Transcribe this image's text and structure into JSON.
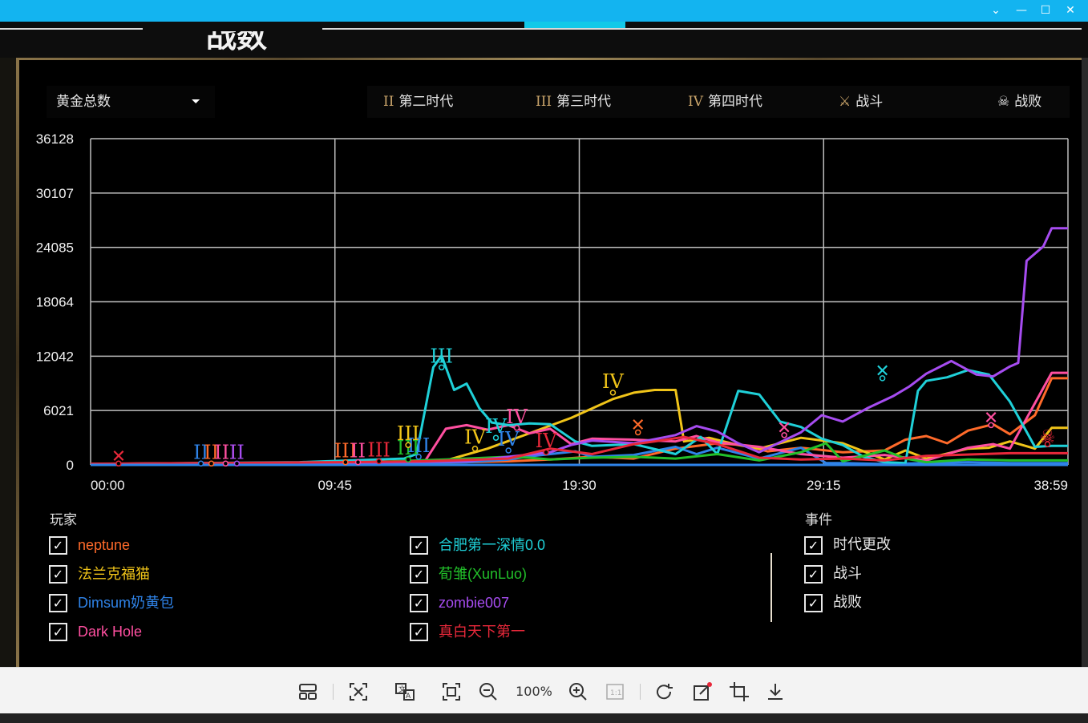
{
  "header": {
    "title": "战数"
  },
  "window_buttons": {
    "dropdown": "⌄",
    "minimize": "—",
    "maximize": "☐",
    "close": "✕"
  },
  "stat_select": {
    "value": "黄金总数",
    "arrow": "⏷"
  },
  "events_bar": [
    {
      "roman": "II",
      "label": "第二时代"
    },
    {
      "roman": "III",
      "label": "第三时代"
    },
    {
      "roman": "IV",
      "label": "第四时代"
    },
    {
      "icon": "⚔",
      "label": "战斗"
    },
    {
      "icon": "☠",
      "label": "战败"
    }
  ],
  "chart_data": {
    "type": "line",
    "y_ticks": [
      "36128",
      "30107",
      "24085",
      "18064",
      "12042",
      "6021",
      "0"
    ],
    "x_ticks": [
      "00:00",
      "09:45",
      "19:30",
      "29:15",
      "38:59"
    ],
    "ylim": [
      0,
      36128
    ],
    "grid": true,
    "x_range_seconds": [
      0,
      2339
    ],
    "series": [
      {
        "name": "neptune",
        "color": "#ff6a2a",
        "points": [
          [
            0,
            100
          ],
          [
            300,
            200
          ],
          [
            600,
            150
          ],
          [
            900,
            300
          ],
          [
            1000,
            400
          ],
          [
            1100,
            600
          ],
          [
            1200,
            900
          ],
          [
            1300,
            700
          ],
          [
            1400,
            1800
          ],
          [
            1500,
            2400
          ],
          [
            1560,
            2200
          ],
          [
            1620,
            1500
          ],
          [
            1700,
            1900
          ],
          [
            1800,
            1400
          ],
          [
            1900,
            1600
          ],
          [
            1950,
            2800
          ],
          [
            2000,
            3200
          ],
          [
            2050,
            2400
          ],
          [
            2100,
            3800
          ],
          [
            2160,
            4500
          ],
          [
            2200,
            3400
          ],
          [
            2260,
            5500
          ],
          [
            2300,
            9600
          ],
          [
            2339,
            9600
          ]
        ]
      },
      {
        "name": "法兰克福猫",
        "color": "#f0c419",
        "points": [
          [
            0,
            80
          ],
          [
            600,
            200
          ],
          [
            850,
            500
          ],
          [
            950,
            1800
          ],
          [
            1050,
            3500
          ],
          [
            1150,
            5200
          ],
          [
            1250,
            7300
          ],
          [
            1300,
            8000
          ],
          [
            1350,
            8300
          ],
          [
            1400,
            8300
          ],
          [
            1420,
            2600
          ],
          [
            1480,
            3000
          ],
          [
            1550,
            2200
          ],
          [
            1600,
            1800
          ],
          [
            1700,
            3000
          ],
          [
            1800,
            2400
          ],
          [
            1900,
            600
          ],
          [
            1950,
            1600
          ],
          [
            2000,
            700
          ],
          [
            2100,
            1800
          ],
          [
            2150,
            1900
          ],
          [
            2200,
            2600
          ],
          [
            2260,
            1800
          ],
          [
            2300,
            4100
          ],
          [
            2339,
            4100
          ]
        ]
      },
      {
        "name": "Dimsum奶黄包",
        "color": "#2f83e8",
        "points": [
          [
            0,
            60
          ],
          [
            300,
            100
          ],
          [
            600,
            150
          ],
          [
            900,
            300
          ],
          [
            1000,
            600
          ],
          [
            1060,
            1000
          ],
          [
            1100,
            1200
          ],
          [
            1160,
            1500
          ],
          [
            1200,
            900
          ],
          [
            1300,
            1100
          ],
          [
            1400,
            2000
          ],
          [
            1450,
            1200
          ],
          [
            1500,
            1900
          ],
          [
            1600,
            700
          ],
          [
            1700,
            1900
          ],
          [
            1760,
            200
          ],
          [
            1800,
            200
          ],
          [
            1900,
            100
          ],
          [
            2100,
            300
          ],
          [
            2200,
            200
          ],
          [
            2339,
            200
          ]
        ]
      },
      {
        "name": "Dark Hole",
        "color": "#ff4fa0",
        "points": [
          [
            0,
            70
          ],
          [
            300,
            120
          ],
          [
            600,
            250
          ],
          [
            800,
            400
          ],
          [
            850,
            4000
          ],
          [
            900,
            4400
          ],
          [
            950,
            3900
          ],
          [
            1000,
            4400
          ],
          [
            1050,
            3500
          ],
          [
            1100,
            4000
          ],
          [
            1150,
            2300
          ],
          [
            1200,
            2900
          ],
          [
            1300,
            2800
          ],
          [
            1400,
            2600
          ],
          [
            1450,
            3200
          ],
          [
            1500,
            2500
          ],
          [
            1600,
            2000
          ],
          [
            1700,
            1200
          ],
          [
            1800,
            800
          ],
          [
            1900,
            1100
          ],
          [
            2000,
            500
          ],
          [
            2100,
            1900
          ],
          [
            2160,
            2300
          ],
          [
            2200,
            1800
          ],
          [
            2300,
            10200
          ],
          [
            2339,
            10200
          ]
        ]
      },
      {
        "name": "合肥第一深情0.0",
        "color": "#1fd0d8",
        "points": [
          [
            0,
            100
          ],
          [
            500,
            300
          ],
          [
            750,
            700
          ],
          [
            780,
            1200
          ],
          [
            820,
            10800
          ],
          [
            840,
            12100
          ],
          [
            870,
            8300
          ],
          [
            900,
            9000
          ],
          [
            930,
            6300
          ],
          [
            960,
            4700
          ],
          [
            1000,
            4400
          ],
          [
            1050,
            4600
          ],
          [
            1100,
            4500
          ],
          [
            1160,
            2600
          ],
          [
            1200,
            2100
          ],
          [
            1300,
            2300
          ],
          [
            1400,
            1200
          ],
          [
            1460,
            3100
          ],
          [
            1500,
            1200
          ],
          [
            1550,
            8200
          ],
          [
            1600,
            7800
          ],
          [
            1650,
            4800
          ],
          [
            1700,
            4200
          ],
          [
            1750,
            2900
          ],
          [
            1800,
            2200
          ],
          [
            1850,
            900
          ],
          [
            1900,
            300
          ],
          [
            1950,
            200
          ],
          [
            1980,
            8200
          ],
          [
            2000,
            9300
          ],
          [
            2050,
            9700
          ],
          [
            2100,
            10500
          ],
          [
            2150,
            10000
          ],
          [
            2200,
            7000
          ],
          [
            2260,
            2000
          ],
          [
            2300,
            2100
          ],
          [
            2339,
            2100
          ]
        ]
      },
      {
        "name": "荀雏(XunLuo)",
        "color": "#22c02a",
        "points": [
          [
            0,
            50
          ],
          [
            300,
            100
          ],
          [
            600,
            200
          ],
          [
            850,
            600
          ],
          [
            900,
            700
          ],
          [
            1000,
            900
          ],
          [
            1050,
            800
          ],
          [
            1100,
            600
          ],
          [
            1200,
            800
          ],
          [
            1300,
            900
          ],
          [
            1400,
            700
          ],
          [
            1500,
            1200
          ],
          [
            1600,
            500
          ],
          [
            1700,
            1400
          ],
          [
            1760,
            2400
          ],
          [
            1800,
            400
          ],
          [
            1900,
            1600
          ],
          [
            1950,
            700
          ],
          [
            2000,
            300
          ],
          [
            2100,
            600
          ],
          [
            2200,
            500
          ],
          [
            2339,
            500
          ]
        ]
      },
      {
        "name": "zombie007",
        "color": "#a64cf0",
        "points": [
          [
            0,
            70
          ],
          [
            300,
            100
          ],
          [
            600,
            200
          ],
          [
            900,
            400
          ],
          [
            1000,
            900
          ],
          [
            1100,
            1400
          ],
          [
            1150,
            2200
          ],
          [
            1200,
            2700
          ],
          [
            1300,
            2400
          ],
          [
            1400,
            3300
          ],
          [
            1450,
            4300
          ],
          [
            1500,
            3700
          ],
          [
            1550,
            2400
          ],
          [
            1600,
            1400
          ],
          [
            1700,
            3600
          ],
          [
            1750,
            5500
          ],
          [
            1800,
            4800
          ],
          [
            1860,
            6300
          ],
          [
            1920,
            7600
          ],
          [
            1960,
            8700
          ],
          [
            2000,
            10100
          ],
          [
            2060,
            11500
          ],
          [
            2120,
            10000
          ],
          [
            2160,
            9800
          ],
          [
            2200,
            10900
          ],
          [
            2220,
            11300
          ],
          [
            2240,
            22600
          ],
          [
            2280,
            24200
          ],
          [
            2300,
            26200
          ],
          [
            2339,
            26200
          ]
        ]
      },
      {
        "name": "真白天下第一",
        "color": "#e8283a",
        "points": [
          [
            0,
            120
          ],
          [
            300,
            200
          ],
          [
            600,
            300
          ],
          [
            800,
            400
          ],
          [
            1000,
            700
          ],
          [
            1100,
            1800
          ],
          [
            1200,
            1200
          ],
          [
            1300,
            2300
          ],
          [
            1350,
            2600
          ],
          [
            1420,
            3100
          ],
          [
            1500,
            2300
          ],
          [
            1600,
            800
          ],
          [
            1700,
            600
          ],
          [
            1800,
            700
          ],
          [
            1900,
            500
          ],
          [
            2000,
            1000
          ],
          [
            2200,
            1300
          ],
          [
            2339,
            1300
          ]
        ]
      }
    ],
    "event_markers": [
      {
        "type": "battle",
        "t": 67,
        "v": 150,
        "color": "#e8283a",
        "icon": "✕"
      },
      {
        "type": "age",
        "t": 264,
        "v": 150,
        "color": "#2f83e8",
        "label": "II"
      },
      {
        "type": "age",
        "t": 289,
        "v": 150,
        "color": "#ff6a2a",
        "label": "II"
      },
      {
        "type": "age",
        "t": 323,
        "v": 150,
        "color": "#ff4fa0",
        "label": "III"
      },
      {
        "type": "age",
        "t": 350,
        "v": 150,
        "color": "#a64cf0",
        "label": "II"
      },
      {
        "type": "age",
        "t": 610,
        "v": 300,
        "color": "#ff6a2a",
        "label": "III"
      },
      {
        "type": "age",
        "t": 640,
        "v": 300,
        "color": "#ff4fa0",
        "label": "II"
      },
      {
        "type": "age",
        "t": 690,
        "v": 400,
        "color": "#e8283a",
        "label": "III"
      },
      {
        "type": "age",
        "t": 760,
        "v": 600,
        "color": "#22c02a",
        "label": "III"
      },
      {
        "type": "age",
        "t": 785,
        "v": 900,
        "color": "#2f83e8",
        "label": "III"
      },
      {
        "type": "age",
        "t": 760,
        "v": 2200,
        "color": "#f0c419",
        "label": "III"
      },
      {
        "type": "age",
        "t": 840,
        "v": 10800,
        "color": "#1fd0d8",
        "label": "III"
      },
      {
        "type": "age",
        "t": 920,
        "v": 1800,
        "color": "#f0c419",
        "label": "IV"
      },
      {
        "type": "age",
        "t": 970,
        "v": 3000,
        "color": "#1fd0d8",
        "label": "IV"
      },
      {
        "type": "age",
        "t": 1000,
        "v": 1600,
        "color": "#2f83e8",
        "label": "IV"
      },
      {
        "type": "age",
        "t": 1020,
        "v": 4100,
        "color": "#ff4fa0",
        "label": "IV"
      },
      {
        "type": "age",
        "t": 1090,
        "v": 1400,
        "color": "#e8283a",
        "label": "IV"
      },
      {
        "type": "age",
        "t": 1250,
        "v": 8000,
        "color": "#f0c419",
        "label": "IV"
      },
      {
        "type": "battle",
        "t": 1310,
        "v": 3600,
        "color": "#ff6a2a",
        "icon": "✕"
      },
      {
        "type": "battle",
        "t": 1660,
        "v": 3300,
        "color": "#ff4fa0",
        "icon": "✕"
      },
      {
        "type": "battle",
        "t": 1895,
        "v": 9600,
        "color": "#1fd0d8",
        "icon": "✕"
      },
      {
        "type": "battle",
        "t": 2155,
        "v": 4400,
        "color": "#ff4fa0",
        "icon": "✕"
      },
      {
        "type": "defeat",
        "t": 2290,
        "v": 2300,
        "color": "#e8283a",
        "icon": "☠"
      }
    ]
  },
  "legend": {
    "players_title": "玩家",
    "events_title": "事件",
    "players": [
      {
        "name": "neptune",
        "color": "#ff6a2a"
      },
      {
        "name": "法兰克福猫",
        "color": "#f0c419"
      },
      {
        "name": "Dimsum奶黄包",
        "color": "#2f83e8"
      },
      {
        "name": "Dark Hole",
        "color": "#ff4fa0"
      },
      {
        "name": "合肥第一深情0.0",
        "color": "#1fd0d8"
      },
      {
        "name": "荀雏(XunLuo)",
        "color": "#22c02a"
      },
      {
        "name": "zombie007",
        "color": "#a64cf0"
      },
      {
        "name": "真白天下第一",
        "color": "#e8283a"
      }
    ],
    "events": [
      {
        "name": "时代更改"
      },
      {
        "name": "战斗"
      },
      {
        "name": "战败"
      }
    ],
    "check": "✓"
  },
  "viewer": {
    "zoom": "100%",
    "icons": [
      "grid-view-icon",
      "text-recognition-icon",
      "translate-icon",
      "fit-screen-icon",
      "zoom-out-icon",
      "zoom-in-icon",
      "actual-size-icon",
      "rotate-icon",
      "edit-icon",
      "crop-icon",
      "download-icon"
    ]
  }
}
